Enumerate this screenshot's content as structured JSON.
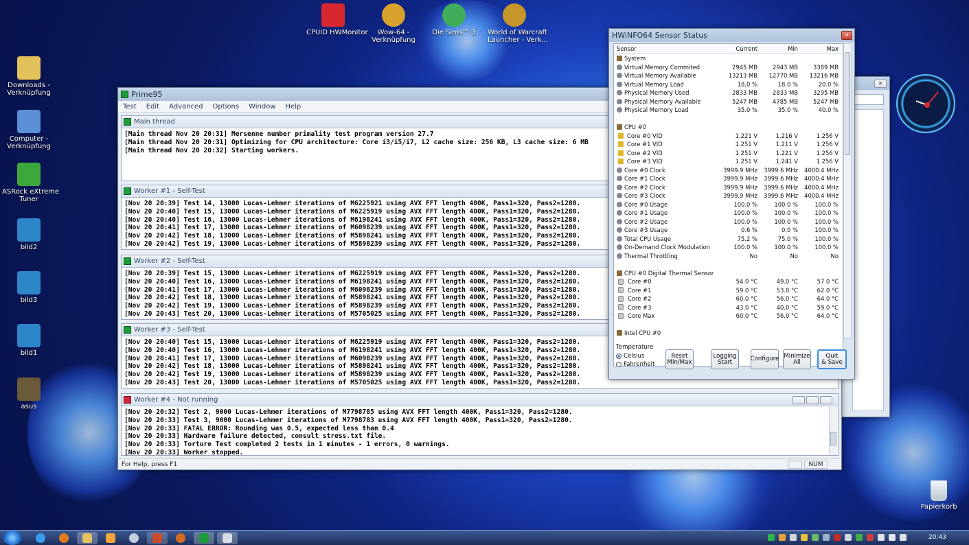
{
  "desktop": {
    "left_icons": [
      {
        "label": "Downloads -\nVerknüpfung"
      },
      {
        "label": "Computer -\nVerknüpfung"
      },
      {
        "label": "ASRock eXtreme\nTuner"
      },
      {
        "label": "bild2"
      },
      {
        "label": "bild3"
      },
      {
        "label": "bild1"
      },
      {
        "label": "asus"
      }
    ],
    "top_icons": [
      {
        "label": "CPUID HWMonitor"
      },
      {
        "label": "Wow-64 -\nVerknüpfung"
      },
      {
        "label": "Die Sims™ 3"
      },
      {
        "label": "World of Warcraft\nLauncher - Verk..."
      }
    ],
    "recycle_bin": "Papierkorb"
  },
  "prime95": {
    "title": "Prime95",
    "menu": [
      "Test",
      "Edit",
      "Advanced",
      "Options",
      "Window",
      "Help"
    ],
    "main_thread": {
      "title": "Main thread",
      "lines": [
        "[Main thread Nov 20 20:31] Mersenne number primality test program version 27.7",
        "[Main thread Nov 20 20:31] Optimizing for CPU architecture: Core i3/i5/i7, L2 cache size: 256 KB, L3 cache size: 6 MB",
        "[Main thread Nov 20 20:32] Starting workers."
      ]
    },
    "workers": [
      {
        "title": "Worker #1 - Self-Test",
        "lines": [
          "[Nov 20 20:39] Test 14, 13000 Lucas-Lehmer iterations of M6225921 using AVX FFT length 400K, Pass1=320, Pass2=1280.",
          "[Nov 20 20:40] Test 15, 13000 Lucas-Lehmer iterations of M6225919 using AVX FFT length 400K, Pass1=320, Pass2=1280.",
          "[Nov 20 20:40] Test 16, 13000 Lucas-Lehmer iterations of M6198241 using AVX FFT length 400K, Pass1=320, Pass2=1280.",
          "[Nov 20 20:41] Test 17, 13000 Lucas-Lehmer iterations of M6098239 using AVX FFT length 400K, Pass1=320, Pass2=1280.",
          "[Nov 20 20:42] Test 18, 13000 Lucas-Lehmer iterations of M5898241 using AVX FFT length 400K, Pass1=320, Pass2=1280.",
          "[Nov 20 20:42] Test 19, 13000 Lucas-Lehmer iterations of M5898239 using AVX FFT length 400K, Pass1=320, Pass2=1280."
        ]
      },
      {
        "title": "Worker #2 - Self-Test",
        "lines": [
          "[Nov 20 20:39] Test 15, 13000 Lucas-Lehmer iterations of M6225919 using AVX FFT length 400K, Pass1=320, Pass2=1280.",
          "[Nov 20 20:40] Test 16, 13000 Lucas-Lehmer iterations of M6198241 using AVX FFT length 400K, Pass1=320, Pass2=1280.",
          "[Nov 20 20:41] Test 17, 13000 Lucas-Lehmer iterations of M6098239 using AVX FFT length 400K, Pass1=320, Pass2=1280.",
          "[Nov 20 20:42] Test 18, 13000 Lucas-Lehmer iterations of M5898241 using AVX FFT length 400K, Pass1=320, Pass2=1280.",
          "[Nov 20 20:42] Test 19, 13000 Lucas-Lehmer iterations of M5898239 using AVX FFT length 400K, Pass1=320, Pass2=1280.",
          "[Nov 20 20:43] Test 20, 13000 Lucas-Lehmer iterations of M5705025 using AVX FFT length 400K, Pass1=320, Pass2=1280."
        ]
      },
      {
        "title": "Worker #3 - Self-Test",
        "lines": [
          "[Nov 20 20:40] Test 15, 13000 Lucas-Lehmer iterations of M6225919 using AVX FFT length 400K, Pass1=320, Pass2=1280.",
          "[Nov 20 20:40] Test 16, 13000 Lucas-Lehmer iterations of M6198241 using AVX FFT length 400K, Pass1=320, Pass2=1280.",
          "[Nov 20 20:41] Test 17, 13000 Lucas-Lehmer iterations of M6098239 using AVX FFT length 400K, Pass1=320, Pass2=1280.",
          "[Nov 20 20:42] Test 18, 13000 Lucas-Lehmer iterations of M5898241 using AVX FFT length 400K, Pass1=320, Pass2=1280.",
          "[Nov 20 20:42] Test 19, 13000 Lucas-Lehmer iterations of M5898239 using AVX FFT length 400K, Pass1=320, Pass2=1280.",
          "[Nov 20 20:43] Test 20, 13000 Lucas-Lehmer iterations of M5705025 using AVX FFT length 400K, Pass1=320, Pass2=1280."
        ]
      },
      {
        "title": "Worker #4 - Not running",
        "lines": [
          "[Nov 20 20:32] Test 2, 9000 Lucas-Lehmer iterations of M7798785 using AVX FFT length 400K, Pass1=320, Pass2=1280.",
          "[Nov 20 20:33] Test 3, 9000 Lucas-Lehmer iterations of M7798783 using AVX FFT length 400K, Pass1=320, Pass2=1280.",
          "[Nov 20 20:33] FATAL ERROR: Rounding was 0.5, expected less than 0.4",
          "[Nov 20 20:33] Hardware failure detected, consult stress.txt file.",
          "[Nov 20 20:33] Torture Test completed 2 tests in 1 minutes - 1 errors, 0 warnings.",
          "[Nov 20 20:33] Worker stopped."
        ]
      }
    ],
    "status_text": "For Help, press F1",
    "status_num": "NUM"
  },
  "hwinfo": {
    "title": "HWiNFO64 Sensor Status",
    "columns": [
      "Sensor",
      "Current",
      "Min",
      "Max"
    ],
    "rows": [
      {
        "type": "group",
        "name": "System"
      },
      {
        "type": "row",
        "icon": "gauge",
        "name": "Virtual Memory Commited",
        "cur": "2945 MB",
        "min": "2943 MB",
        "max": "3389 MB"
      },
      {
        "type": "row",
        "icon": "gauge",
        "name": "Virtual Memory Available",
        "cur": "13213 MB",
        "min": "12770 MB",
        "max": "13216 MB"
      },
      {
        "type": "row",
        "icon": "gauge",
        "name": "Virtual Memory Load",
        "cur": "18.0 %",
        "min": "18.0 %",
        "max": "20.0 %"
      },
      {
        "type": "row",
        "icon": "gauge",
        "name": "Physical Memory Used",
        "cur": "2833 MB",
        "min": "2833 MB",
        "max": "3295 MB"
      },
      {
        "type": "row",
        "icon": "gauge",
        "name": "Physical Memory Available",
        "cur": "5247 MB",
        "min": "4785 MB",
        "max": "5247 MB"
      },
      {
        "type": "row",
        "icon": "gauge",
        "name": "Physical Memory Load",
        "cur": "35.0 %",
        "min": "35.0 %",
        "max": "40.0 %"
      },
      {
        "type": "blank"
      },
      {
        "type": "group",
        "name": "CPU #0"
      },
      {
        "type": "row",
        "icon": "volt",
        "name": "Core #0 VID",
        "cur": "1.221 V",
        "min": "1.216 V",
        "max": "1.256 V"
      },
      {
        "type": "row",
        "icon": "volt",
        "name": "Core #1 VID",
        "cur": "1.251 V",
        "min": "1.211 V",
        "max": "1.256 V"
      },
      {
        "type": "row",
        "icon": "volt",
        "name": "Core #2 VID",
        "cur": "1.251 V",
        "min": "1.221 V",
        "max": "1.256 V"
      },
      {
        "type": "row",
        "icon": "volt",
        "name": "Core #3 VID",
        "cur": "1.251 V",
        "min": "1.241 V",
        "max": "1.256 V"
      },
      {
        "type": "row",
        "icon": "gauge",
        "name": "Core #0 Clock",
        "cur": "3999.9 MHz",
        "min": "3999.6 MHz",
        "max": "4000.4 MHz"
      },
      {
        "type": "row",
        "icon": "gauge",
        "name": "Core #1 Clock",
        "cur": "3999.9 MHz",
        "min": "3999.6 MHz",
        "max": "4000.4 MHz"
      },
      {
        "type": "row",
        "icon": "gauge",
        "name": "Core #2 Clock",
        "cur": "3999.9 MHz",
        "min": "3999.6 MHz",
        "max": "4000.4 MHz"
      },
      {
        "type": "row",
        "icon": "gauge",
        "name": "Core #3 Clock",
        "cur": "3999.9 MHz",
        "min": "3999.6 MHz",
        "max": "4000.4 MHz"
      },
      {
        "type": "row",
        "icon": "gauge",
        "name": "Core #0 Usage",
        "cur": "100.0 %",
        "min": "100.0 %",
        "max": "100.0 %"
      },
      {
        "type": "row",
        "icon": "gauge",
        "name": "Core #1 Usage",
        "cur": "100.0 %",
        "min": "100.0 %",
        "max": "100.0 %"
      },
      {
        "type": "row",
        "icon": "gauge",
        "name": "Core #2 Usage",
        "cur": "100.0 %",
        "min": "100.0 %",
        "max": "100.0 %"
      },
      {
        "type": "row",
        "icon": "gauge",
        "name": "Core #3 Usage",
        "cur": "0.6 %",
        "min": "0.0 %",
        "max": "100.0 %"
      },
      {
        "type": "row",
        "icon": "gauge",
        "name": "Total CPU Usage",
        "cur": "75.2 %",
        "min": "75.0 %",
        "max": "100.0 %"
      },
      {
        "type": "row",
        "icon": "gauge",
        "name": "On-Demand Clock Modulation",
        "cur": "100.0 %",
        "min": "100.0 %",
        "max": "100.0 %"
      },
      {
        "type": "row",
        "icon": "gauge",
        "name": "Thermal Throttling",
        "cur": "No",
        "min": "No",
        "max": "No"
      },
      {
        "type": "blank"
      },
      {
        "type": "group",
        "name": "CPU #0 Digital Thermal Sensor"
      },
      {
        "type": "row",
        "icon": "temp",
        "name": "Core #0",
        "cur": "54.0 °C",
        "min": "49.0 °C",
        "max": "57.0 °C"
      },
      {
        "type": "row",
        "icon": "temp",
        "name": "Core #1",
        "cur": "59.0 °C",
        "min": "53.0 °C",
        "max": "62.0 °C"
      },
      {
        "type": "row",
        "icon": "temp",
        "name": "Core #2",
        "cur": "60.0 °C",
        "min": "56.0 °C",
        "max": "64.0 °C"
      },
      {
        "type": "row",
        "icon": "temp",
        "name": "Core #3",
        "cur": "43.0 °C",
        "min": "40.0 °C",
        "max": "59.0 °C"
      },
      {
        "type": "row",
        "icon": "temp",
        "name": "Core Max",
        "cur": "60.0 °C",
        "min": "56.0 °C",
        "max": "64.0 °C"
      },
      {
        "type": "blank"
      },
      {
        "type": "group",
        "name": "Intel CPU #0"
      }
    ],
    "temperature": {
      "label": "Temperature",
      "celsius": "Celsius",
      "fahrenheit": "Fahrenheit",
      "selected": "Celsius"
    },
    "buttons": {
      "reset": "Reset\nMin/Max",
      "logging": "Logging\nStart",
      "configure": "Configure",
      "minimize": "Minimize\nAll",
      "quit": "Quit\n& Save"
    }
  },
  "taskbar": {
    "clock": "20:43"
  },
  "colors": {
    "accent": "#1e9c3b",
    "error": "#d0283a",
    "desktop": "#0f2482"
  }
}
